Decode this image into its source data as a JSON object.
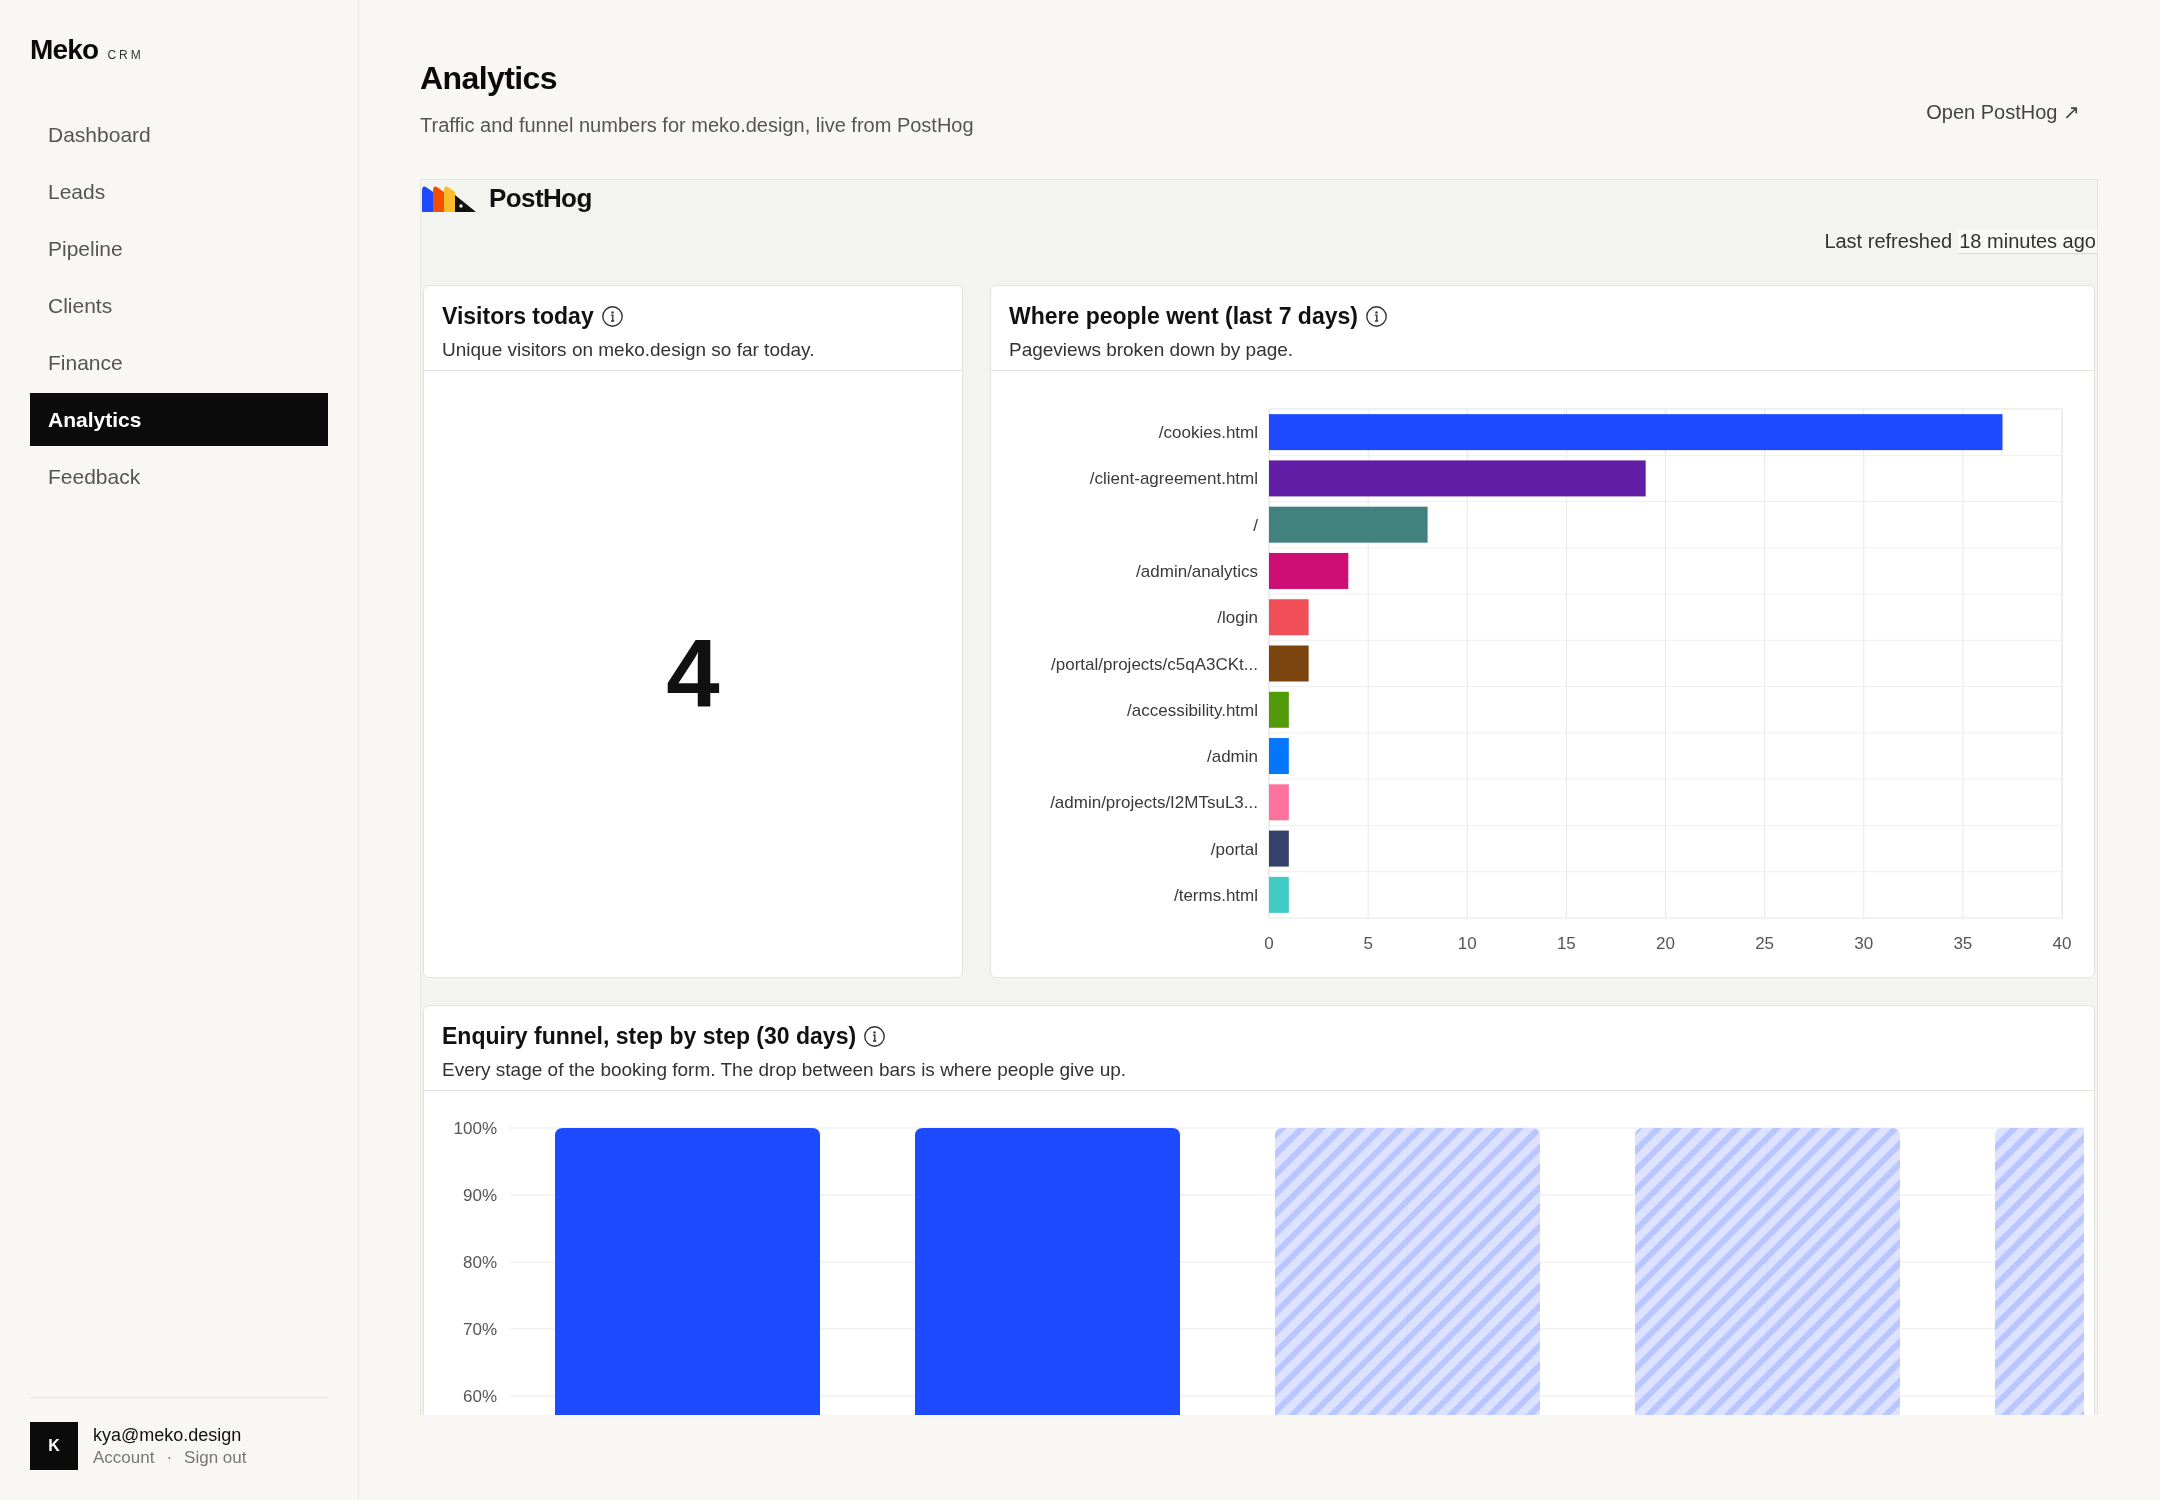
{
  "sidebar": {
    "brand": "Meko",
    "brand_tag": "CRM",
    "items": [
      {
        "label": "Dashboard",
        "selected": false
      },
      {
        "label": "Leads",
        "selected": false
      },
      {
        "label": "Pipeline",
        "selected": false
      },
      {
        "label": "Clients",
        "selected": false
      },
      {
        "label": "Finance",
        "selected": false
      },
      {
        "label": "Analytics",
        "selected": true
      },
      {
        "label": "Feedback",
        "selected": false
      }
    ],
    "user": {
      "avatar_initial": "K",
      "email": "kya@meko.design",
      "links": [
        "Account",
        "Sign out"
      ],
      "separator": "·"
    }
  },
  "header": {
    "title": "Analytics",
    "subtitle": "Traffic and funnel numbers for meko.design, live from PostHog",
    "link": "Open PostHog ↗"
  },
  "embed": {
    "brand": "PostHog",
    "refreshed_label": "Last refreshed",
    "refreshed_time": "18 minutes ago",
    "cards": [
      {
        "kind": "number",
        "title": "Visitors today",
        "description": "Unique visitors on meko.design so far today.",
        "value": "4"
      },
      {
        "kind": "bar_chart",
        "title": "Where people went (last 7 days)",
        "description": "Pageviews broken down by page.",
        "chart_data": {
          "type": "bar",
          "orientation": "horizontal",
          "grid": true,
          "categories": [
            "/cookies.html",
            "/client-agreement.html",
            "/",
            "/admin/analytics",
            "/login",
            "/portal/projects/c5qA3CKt...",
            "/accessibility.html",
            "/admin",
            "/admin/projects/I2MTsuL3...",
            "/portal",
            "/terms.html"
          ],
          "series": [
            {
              "values": [
                37,
                19,
                8,
                4,
                2,
                2,
                1,
                1,
                1,
                1,
                1
              ],
              "colors": [
                "#1d4aff",
                "#621da6",
                "#42827e",
                "#ce0e74",
                "#f14f58",
                "#7c440e",
                "#529a0a",
                "#0476fb",
                "#fe729e",
                "#35416b",
                "#41cbc4"
              ]
            }
          ],
          "xlim": [
            0,
            40
          ],
          "xticks": [
            0,
            5,
            10,
            15,
            20,
            25,
            30,
            35,
            40
          ]
        }
      },
      {
        "kind": "funnel",
        "title": "Enquiry funnel, step by step (30 days)",
        "description": "Every stage of the booking form. The drop between bars is where people give up.",
        "chart_data": {
          "type": "bar",
          "orientation": "vertical",
          "grid": true,
          "ylim": [
            57,
            100
          ],
          "yticks": [
            {
              "value": 100,
              "label": "100%"
            },
            {
              "value": 90,
              "label": "90%"
            },
            {
              "value": 80,
              "label": "80%"
            },
            {
              "value": 70,
              "label": "70%"
            },
            {
              "value": 60,
              "label": "60%"
            }
          ],
          "series": [
            {
              "color": "#1d4aff",
              "values": [
                100,
                100,
                null,
                null,
                null
              ]
            },
            {
              "color": "#d3dbff",
              "values": [
                null,
                null,
                100,
                100,
                100
              ]
            }
          ]
        }
      }
    ]
  }
}
